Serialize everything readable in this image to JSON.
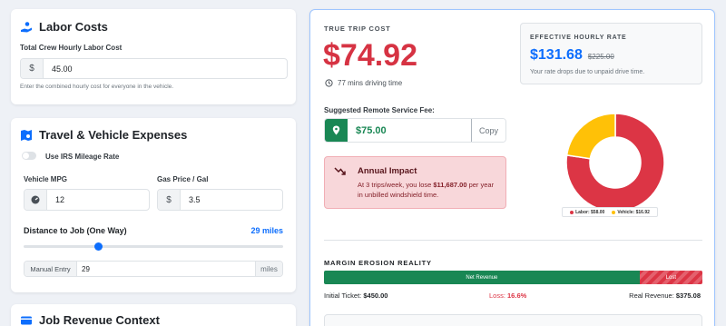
{
  "labor": {
    "title": "Labor Costs",
    "label": "Total Crew Hourly Labor Cost",
    "currency": "$",
    "value": "45.00",
    "help": "Enter the combined hourly cost for everyone in the vehicle."
  },
  "travel": {
    "title": "Travel & Vehicle Expenses",
    "irs_label": "Use IRS Mileage Rate",
    "mpg_label": "Vehicle MPG",
    "mpg_value": "12",
    "gas_label": "Gas Price / Gal",
    "gas_currency": "$",
    "gas_value": "3.5",
    "distance_label": "Distance to Job (One Way)",
    "distance_value": "29 miles",
    "distance_fraction": 0.29,
    "manual_label": "Manual Entry",
    "manual_value": "29",
    "manual_unit": "miles"
  },
  "revenue": {
    "title": "Job Revenue Context"
  },
  "result": {
    "true_cost_label": "TRUE TRIP COST",
    "true_cost_value": "$74.92",
    "driving_time": "77 mins driving time",
    "effective_label": "EFFECTIVE HOURLY RATE",
    "effective_value": "$131.68",
    "effective_old": "$225.00",
    "effective_note": "Your rate drops due to unpaid drive time.",
    "fee_label": "Suggested Remote Service Fee:",
    "fee_value": "$75.00",
    "copy_label": "Copy",
    "impact_title": "Annual Impact",
    "impact_pre": "At 3 trips/week, you lose ",
    "impact_amount": "$11,687.00",
    "impact_post": " per year in unbilled windshield time.",
    "margin_title": "MARGIN EROSION REALITY",
    "net_label": "Net Revenue",
    "lost_label": "Lost",
    "net_fraction": 0.834,
    "initial_label": "Initial Ticket: ",
    "initial_value": "$450.00",
    "loss_label": "Loss: ",
    "loss_value": "16.6%",
    "real_label": "Real Revenue: ",
    "real_value": "$375.08"
  },
  "chart_data": {
    "type": "pie",
    "categories": [
      "Labor",
      "Vehicle"
    ],
    "values": [
      58.0,
      16.92
    ],
    "legend": [
      "Labor: $58.00",
      "Vehicle: $16.92"
    ],
    "colors": [
      "#dc3545",
      "#ffc107"
    ],
    "legend_placement": "bottom"
  },
  "colors": {
    "danger": "#d63343",
    "primary": "#0d6efd",
    "success": "#198754",
    "warning": "#ffc107"
  }
}
